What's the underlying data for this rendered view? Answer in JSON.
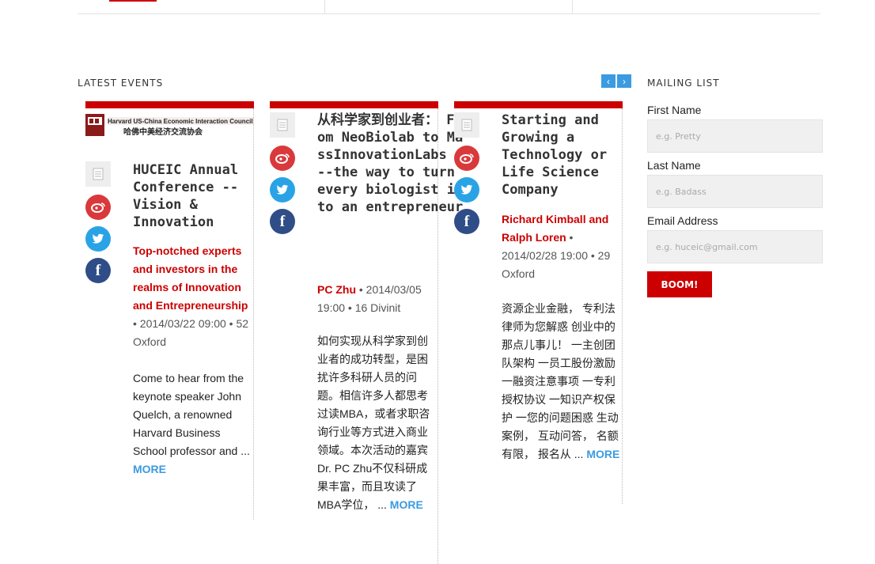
{
  "latest_events": {
    "title": "LATEST EVENTS",
    "nav": {
      "prev": "‹",
      "next": "›"
    },
    "events": [
      {
        "logo_text": "Harvard US-China Economic Interaction Council",
        "logo_chinese": "哈佛中美经济交流协会",
        "title": "HUCEIC Annual Conference -- Vision & Innovation",
        "speaker": "Top-notched experts and investors in the realms of Innovation and Entrepreneurship",
        "datetime": " • 2014/03/22 09:00 • 52 Oxford",
        "excerpt": "Come to hear from the keynote speaker John Quelch, a renowned Harvard Business School professor and ...",
        "more": "MORE"
      },
      {
        "title": "从科学家到创业者： From NeoBiolab to MassInnovationLabs ---the way to turn every biologist into an entrepreneur",
        "speaker": "PC Zhu",
        "datetime": " • 2014/03/05 19:00 • 16 Divinit",
        "excerpt": "如何实现从科学家到创业者的成功转型，是困扰许多科研人员的问题。相信许多人都思考过读MBA，或者求职咨询行业等方式进入商业领域。本次活动的嘉宾Dr. PC Zhu不仅科研成果丰富，而且攻读了MBA学位， ...",
        "more": "MORE"
      },
      {
        "title": "Starting and Growing a Technology or Life Science Company",
        "speaker": "Richard Kimball and Ralph Loren",
        "datetime": " • 2014/02/28 19:00 • 29 Oxford",
        "excerpt": "资源企业金融， 专利法律师为您解惑 创业中的那点儿事儿！ 一主创团队架构 一员工股份激励 一融资注意事项 一专利授权协议 一知识产权保护 一您的问题困惑 生动案例， 互动问答， 名额有限， 报名从 ...",
        "more": "MORE"
      }
    ]
  },
  "mailing_list": {
    "title": "MAILING LIST",
    "first_name_label": "First Name",
    "first_name_placeholder": "e.g. Pretty",
    "last_name_label": "Last Name",
    "last_name_placeholder": "e.g. Badass",
    "email_label": "Email Address",
    "email_placeholder": "e.g. huceic@gmail.com",
    "submit_label": "BOOM!"
  }
}
